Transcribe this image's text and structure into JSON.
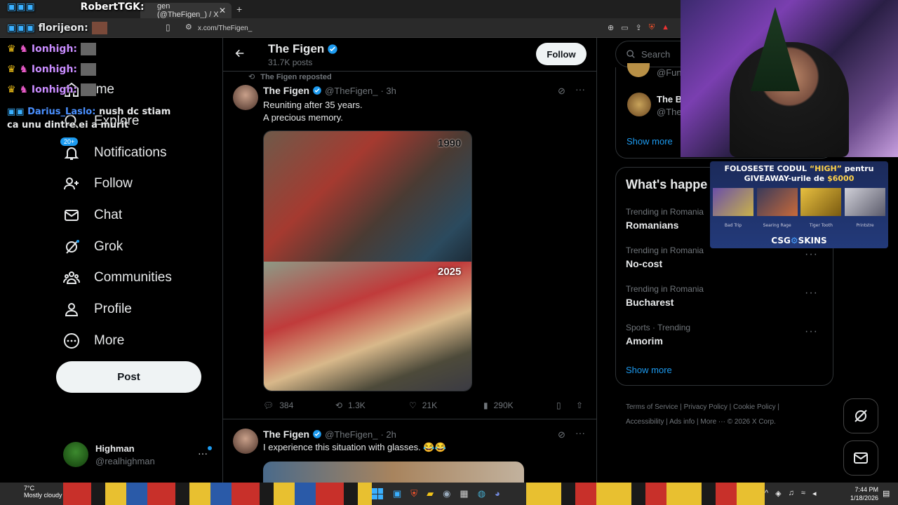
{
  "browser": {
    "tab_title": "gen (@TheFigen_) / X",
    "url": "x.com/TheFigen_",
    "new_tab": "+"
  },
  "sidebar": {
    "items": [
      {
        "label": "ome",
        "icon": "home-icon"
      },
      {
        "label": "Explore",
        "icon": "search-icon"
      },
      {
        "label": "Notifications",
        "icon": "bell-icon",
        "badge": "20+"
      },
      {
        "label": "Follow",
        "icon": "person-plus-icon"
      },
      {
        "label": "Chat",
        "icon": "mail-icon"
      },
      {
        "label": "Grok",
        "icon": "grok-icon"
      },
      {
        "label": "Communities",
        "icon": "communities-icon"
      },
      {
        "label": "Profile",
        "icon": "profile-icon"
      },
      {
        "label": "More",
        "icon": "more-circle-icon"
      }
    ],
    "post_button": "Post",
    "account": {
      "name": "Highman",
      "handle": "@realhighman",
      "more": "···"
    }
  },
  "profile_header": {
    "name": "The Figen",
    "posts": "31.7K posts",
    "follow": "Follow"
  },
  "tweets": [
    {
      "reposted": "The Figen reposted",
      "name": "The Figen",
      "handle": "@TheFigen_",
      "time": "· 3h",
      "text1": "Reuniting after 35 years.",
      "text2": "A precious memory.",
      "img_label_top": "1990",
      "img_label_bottom": "2025",
      "replies": "384",
      "reposts": "1.3K",
      "likes": "21K",
      "views": "290K"
    },
    {
      "name": "The Figen",
      "handle": "@TheFigen_",
      "time": "· 2h",
      "text1": "I experience this situation with glasses. 😂😂"
    }
  ],
  "right": {
    "search_placeholder": "Search",
    "who_to_follow": [
      {
        "name": "",
        "handle": "@Fun"
      },
      {
        "name": "The B",
        "handle": "@The"
      }
    ],
    "show_more": "Show more",
    "whats_happening": "What's happe",
    "trends": [
      {
        "category": "Trending in Romania",
        "title": "Romanians"
      },
      {
        "category": "Trending in Romania",
        "title": "No-cost"
      },
      {
        "category": "Trending in Romania",
        "title": "Bucharest"
      },
      {
        "category": "Sports · Trending",
        "title": "Amorim"
      }
    ],
    "show_more_2": "Show more",
    "footer": [
      "Terms of Service",
      "Privacy Policy",
      "Cookie Policy",
      "Accessibility",
      "Ads info",
      "More ···",
      "© 2026 X Corp."
    ]
  },
  "overlay": {
    "chat": [
      {
        "user": "RobertTGK:",
        "color": "#ffffff"
      },
      {
        "user": "florijeon:",
        "color": "#e7e9ea"
      },
      {
        "user": "Ionhigh:",
        "color": "#c98cff"
      },
      {
        "user": "Ionhigh:",
        "color": "#c98cff"
      },
      {
        "user": "Ionhigh:",
        "color": "#c98cff"
      },
      {
        "user": "Darius_Laslo:",
        "color": "#4a90ff",
        "message": "nush dc stiam ca unu dintre ei a murit"
      }
    ],
    "promo_line1": "FOLOSESTE CODUL",
    "promo_code": "“HIGH”",
    "promo_line1b": "pentru",
    "promo_line2": "GIVEAWAY-urile de",
    "promo_amount": "$6000",
    "promo_brand": "CSG",
    "promo_brand2": "SKINS",
    "skins": [
      "Bad Trip",
      "Searing Rage",
      "Tiger Tooth",
      "Printstre"
    ]
  },
  "taskbar": {
    "weather_temp": "7°C",
    "weather": "Mostly cloudy",
    "time": "7:44 PM",
    "date": "1/18/2026"
  },
  "colors": {
    "accent": "#1d9bf0",
    "bg": "#000000",
    "border": "#2f3336"
  }
}
